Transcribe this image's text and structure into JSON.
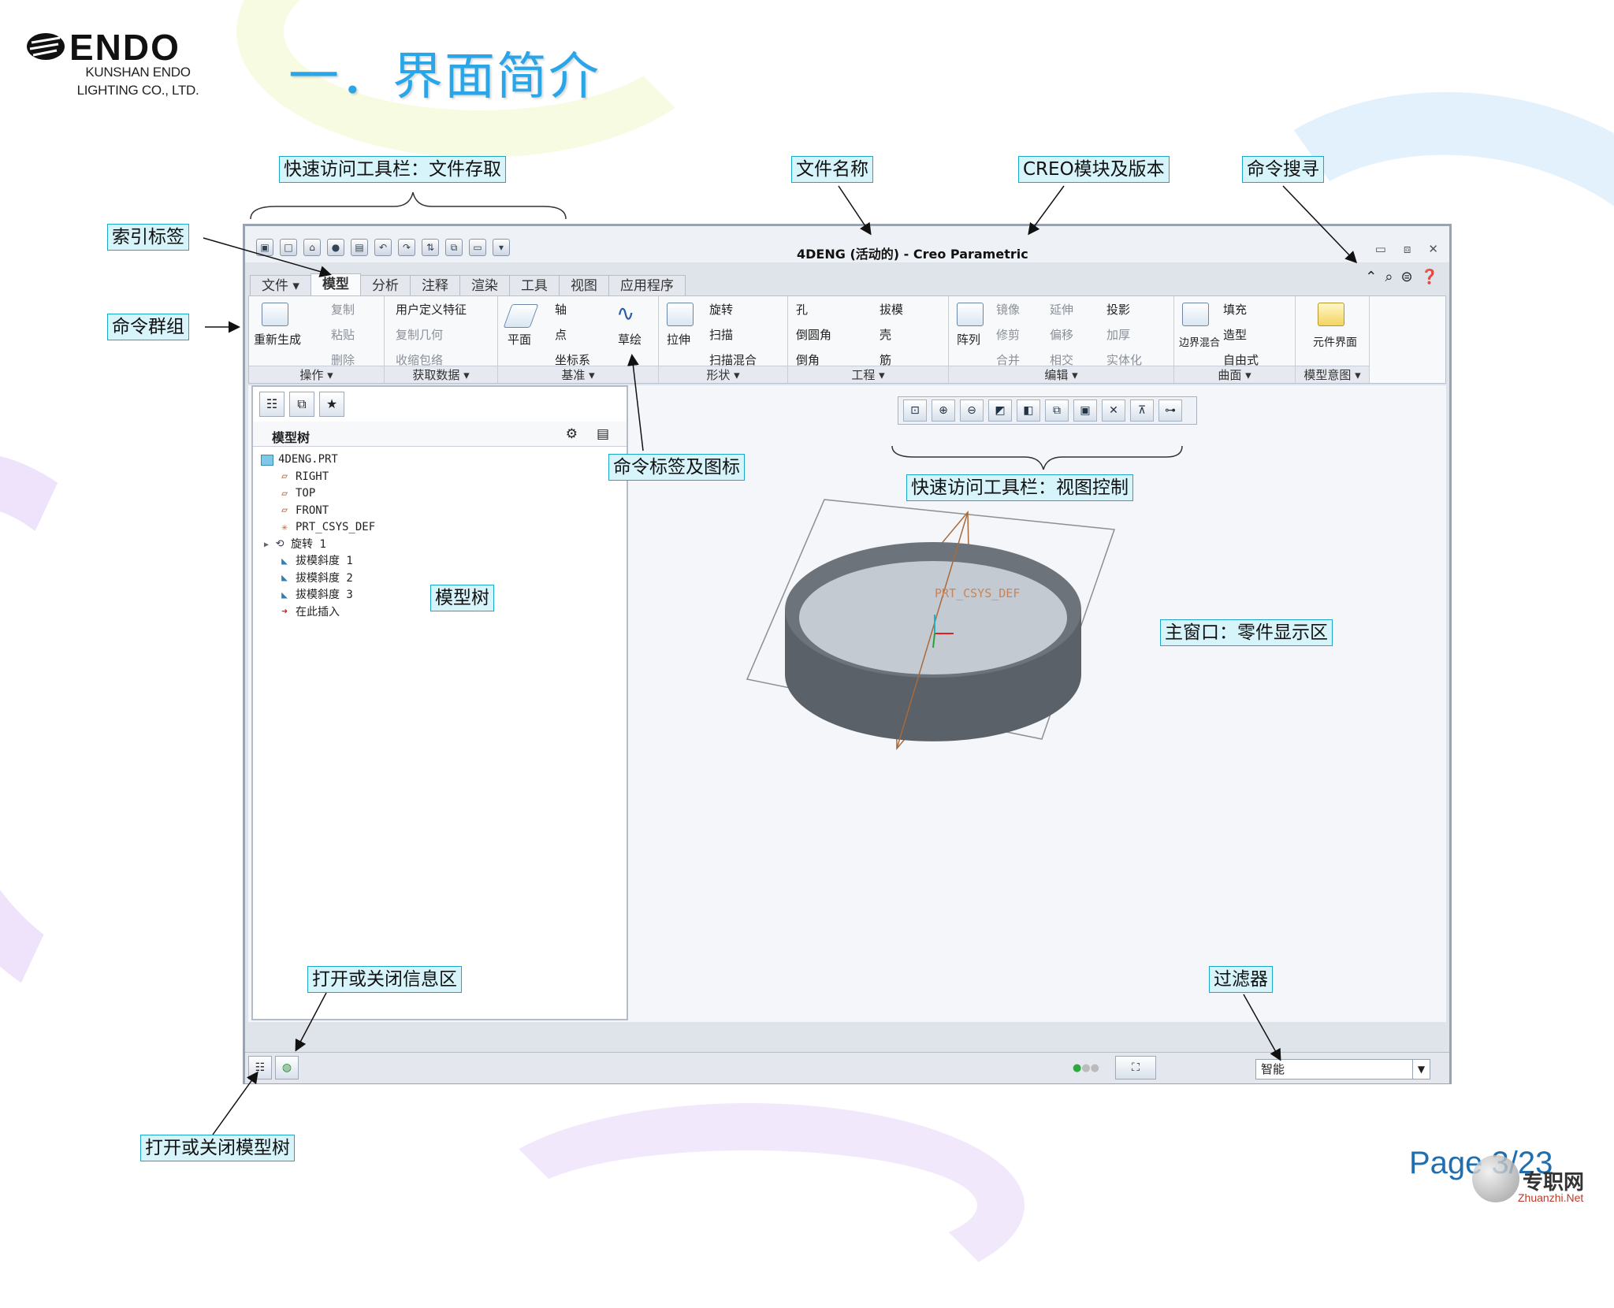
{
  "header": {
    "logo_text": "ENDO",
    "company_line1": "KUNSHAN ENDO",
    "company_line2": "LIGHTING CO., LTD.",
    "slide_title": "一．界面简介"
  },
  "callouts": {
    "quick_access_file": "快速访问工具栏：文件存取",
    "file_name": "文件名称",
    "creo_module": "CREO模块及版本",
    "command_search": "命令搜寻",
    "index_tab": "索引标签",
    "command_group": "命令群组",
    "command_tab_icon": "命令标签及图标",
    "quick_access_view": "快速访问工具栏：视图控制",
    "model_tree": "模型树",
    "main_window": "主窗口：零件显示区",
    "toggle_info": "打开或关闭信息区",
    "filter": "过滤器",
    "toggle_tree": "打开或关闭模型树"
  },
  "window": {
    "title": "4DENG (活动的) - Creo Parametric",
    "tabs": [
      "文件 ▾",
      "模型",
      "分析",
      "注释",
      "渲染",
      "工具",
      "视图",
      "应用程序"
    ],
    "ribbon": {
      "operations": {
        "regen": "重新生成",
        "copy": "复制",
        "paste": "粘贴",
        "delete": "删除",
        "footer": "操作 ▾"
      },
      "get_data": {
        "udf": "用户定义特征",
        "copy_geom": "复制几何",
        "shrinkwrap": "收缩包络",
        "footer": "获取数据 ▾"
      },
      "datum": {
        "plane": "平面",
        "axis": "轴",
        "point": "点",
        "csys": "坐标系",
        "sketch": "草绘",
        "footer": "基准 ▾"
      },
      "shapes": {
        "extrude": "拉伸",
        "revolve": "旋转",
        "sweep": "扫描",
        "swept_blend": "扫描混合",
        "footer": "形状 ▾"
      },
      "engineering": {
        "hole": "孔",
        "round": "倒圆角",
        "chamfer": "倒角",
        "draft": "拔模",
        "shell": "壳",
        "rib": "筋",
        "footer": "工程 ▾"
      },
      "editing": {
        "pattern": "阵列",
        "mirror": "镜像",
        "extend": "延伸",
        "project": "投影",
        "trim": "修剪",
        "offset": "偏移",
        "thicken": "加厚",
        "merge": "合并",
        "intersect": "相交",
        "solidify": "实体化",
        "footer": "编辑 ▾"
      },
      "surfaces": {
        "boundary_blend": "边界混合",
        "fill": "填充",
        "style": "造型",
        "freestyle": "自由式",
        "footer": "曲面 ▾"
      },
      "model_intent": {
        "component_interface": "元件界面",
        "footer": "模型意图 ▾"
      }
    },
    "model_tree": {
      "title": "模型树",
      "items": [
        "4DENG.PRT",
        "RIGHT",
        "TOP",
        "FRONT",
        "PRT_CSYS_DEF",
        "旋转 1",
        "拔模斜度 1",
        "拔模斜度 2",
        "拔模斜度 3",
        "在此插入"
      ]
    },
    "csys_label": "PRT_CSYS_DEF",
    "filter_value": "智能"
  },
  "footer": {
    "page": "Page 3/23",
    "watermark": "专职网",
    "watermark_url": "Zhuanzhi.Net"
  },
  "colors": {
    "title_blue": "#2aa6e8",
    "callout_bg": "#d7f4fb",
    "callout_border": "#1aa7c9",
    "part_gray": "#5b6168",
    "part_top": "#c4cad2"
  }
}
